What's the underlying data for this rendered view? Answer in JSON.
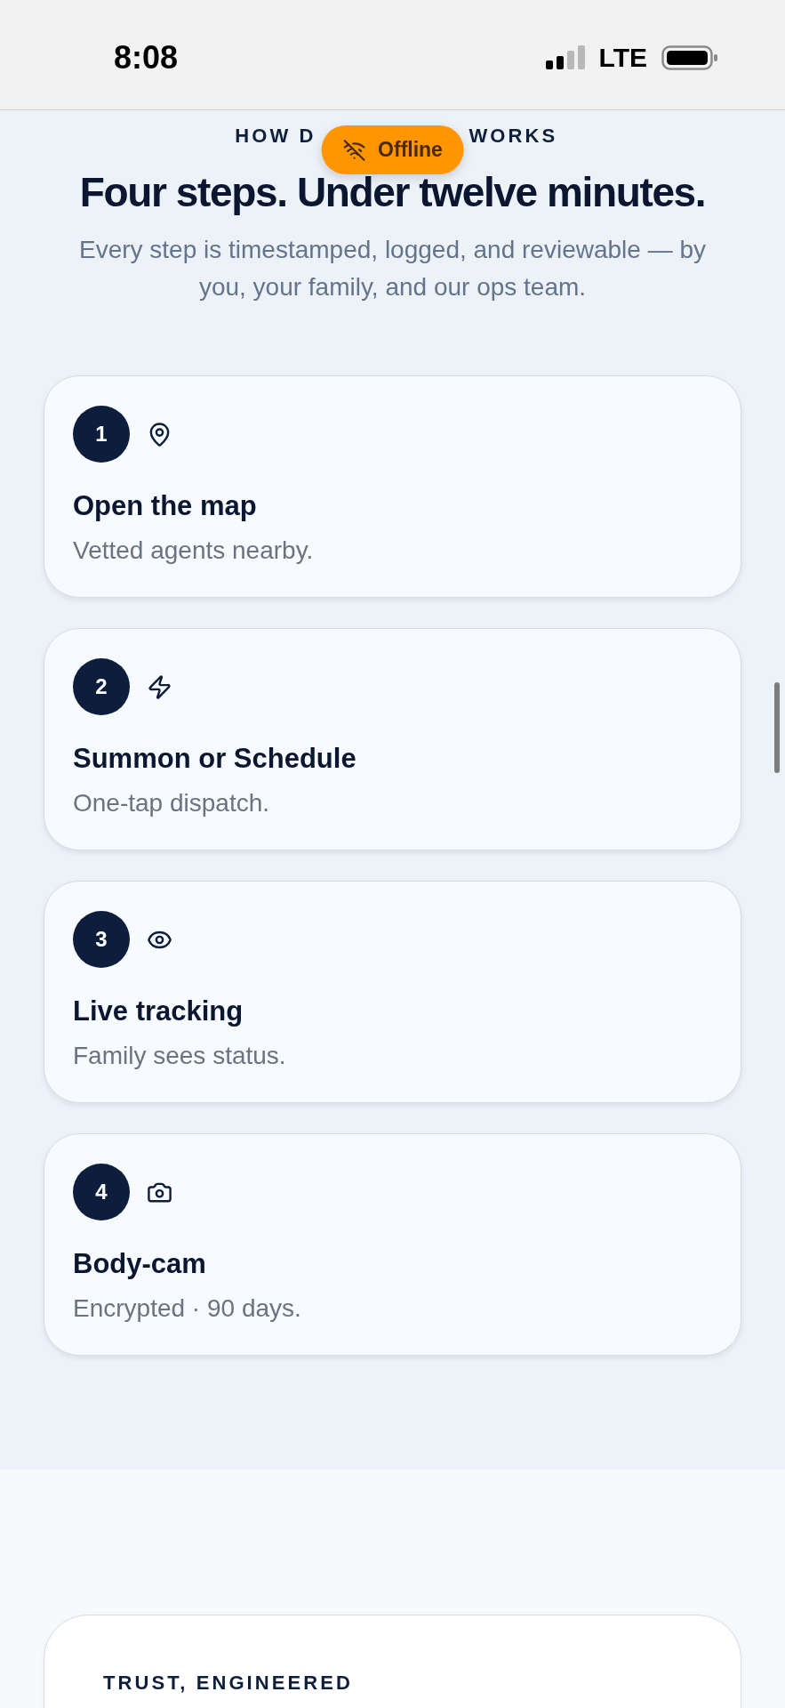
{
  "status_bar": {
    "time": "8:08",
    "network": "LTE"
  },
  "offline_badge": {
    "label": "Offline"
  },
  "how_it_works": {
    "eyebrow_start": "HOW D",
    "eyebrow_end": "WORKS",
    "title": "Four steps. Under twelve minutes.",
    "subtitle": "Every step is timestamped, logged, and reviewable — by you, your family, and our ops team.",
    "steps": [
      {
        "number": "1",
        "kind": "map",
        "title": "Open the map",
        "description": "Vetted agents nearby."
      },
      {
        "number": "2",
        "kind": "dispatch",
        "title": "Summon or Schedule",
        "description": "One-tap dispatch."
      },
      {
        "number": "3",
        "kind": "tracking",
        "title": "Live tracking",
        "description": "Family sees status."
      },
      {
        "number": "4",
        "kind": "recording",
        "title": "Body-cam",
        "description": "Encrypted · 90 days."
      }
    ]
  },
  "trust_section": {
    "eyebrow": "TRUST, ENGINEERED"
  }
}
